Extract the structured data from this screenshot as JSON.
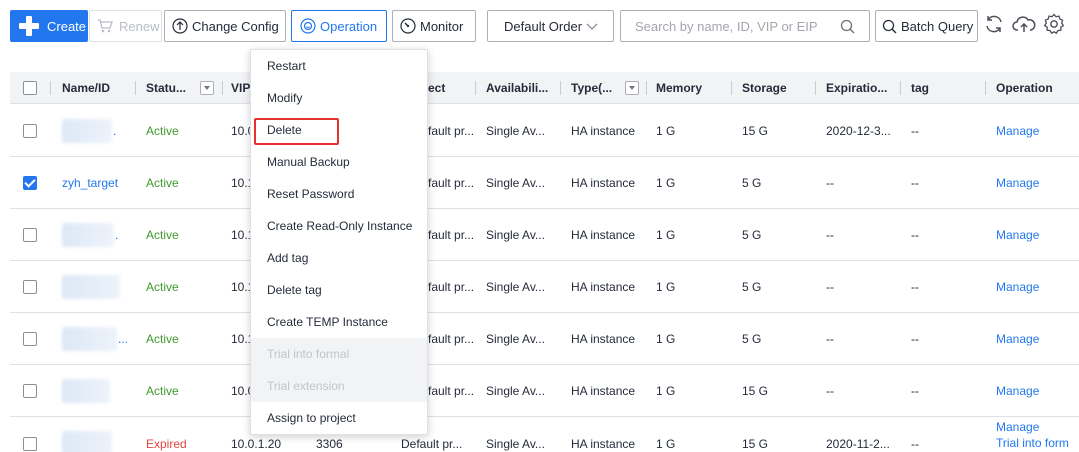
{
  "toolbar": {
    "create_label": "Create",
    "renew_label": "Renew",
    "change_config_label": "Change Config",
    "operation_label": "Operation",
    "monitor_label": "Monitor",
    "order_select_value": "Default Order",
    "search_placeholder": "Search by name, ID, VIP or EIP",
    "batch_query_label": "Batch Query"
  },
  "table": {
    "headers": {
      "name": "Name/ID",
      "status": "Statu...",
      "vip": "VIP",
      "project": "ect",
      "availability": "Availabili...",
      "type": "Type(...",
      "memory": "Memory",
      "storage": "Storage",
      "expiration": "Expiratio...",
      "tag": "tag",
      "operation": "Operation"
    },
    "rows": [
      {
        "name": ".",
        "status": "Active",
        "vip": "10.0",
        "port": "",
        "project": "fault pr...",
        "availability": "Single Av...",
        "type": "HA instance",
        "memory": "1 G",
        "storage": "15 G",
        "expiration": "2020-12-3...",
        "tag": "--",
        "operation": "Manage"
      },
      {
        "name": "zyh_target",
        "status": "Active",
        "vip": "10.1",
        "port": "",
        "project": "fault pr...",
        "availability": "Single Av...",
        "type": "HA instance",
        "memory": "1 G",
        "storage": "5 G",
        "expiration": "--",
        "tag": "--",
        "operation": "Manage"
      },
      {
        "name": ".",
        "status": "Active",
        "vip": "10.1",
        "port": "",
        "project": "fault pr...",
        "availability": "Single Av...",
        "type": "HA instance",
        "memory": "1 G",
        "storage": "5 G",
        "expiration": "--",
        "tag": "--",
        "operation": "Manage"
      },
      {
        "name": "",
        "status": "Active",
        "vip": "10.1",
        "port": "",
        "project": "fault pr...",
        "availability": "Single Av...",
        "type": "HA instance",
        "memory": "1 G",
        "storage": "5 G",
        "expiration": "--",
        "tag": "--",
        "operation": "Manage"
      },
      {
        "name": "...",
        "status": "Active",
        "vip": "10.1",
        "port": "",
        "project": "fault pr...",
        "availability": "Single Av...",
        "type": "HA instance",
        "memory": "1 G",
        "storage": "5 G",
        "expiration": "--",
        "tag": "--",
        "operation": "Manage"
      },
      {
        "name": "",
        "status": "Active",
        "vip": "10.0",
        "port": "",
        "project": "fault pr...",
        "availability": "Single Av...",
        "type": "HA instance",
        "memory": "1 G",
        "storage": "15 G",
        "expiration": "--",
        "tag": "--",
        "operation": "Manage"
      },
      {
        "name": "",
        "status": "Expired",
        "vip": "10.0.1.20",
        "port": "3306",
        "project": "Default pr...",
        "availability": "Single Av...",
        "type": "HA instance",
        "memory": "1 G",
        "storage": "15 G",
        "expiration": "2020-11-2...",
        "tag": "--",
        "operation": "Manage",
        "operation2": "Trial into form"
      }
    ]
  },
  "operation_menu": {
    "items": [
      {
        "label": "Restart",
        "disabled": false
      },
      {
        "label": "Modify",
        "disabled": false
      },
      {
        "label": "Delete",
        "disabled": false
      },
      {
        "label": "Manual Backup",
        "disabled": false
      },
      {
        "label": "Reset Password",
        "disabled": false
      },
      {
        "label": "Create Read-Only Instance",
        "disabled": false
      },
      {
        "label": "Add tag",
        "disabled": false
      },
      {
        "label": "Delete tag",
        "disabled": false
      },
      {
        "label": "Create TEMP Instance",
        "disabled": false
      },
      {
        "label": "Trial into formal",
        "disabled": true
      },
      {
        "label": "Trial extension",
        "disabled": true
      },
      {
        "label": "Assign to project",
        "disabled": false
      }
    ],
    "highlighted_item": "Delete",
    "highlight_color": "#e5322d"
  },
  "colors": {
    "primary": "#2277ee",
    "active_status": "#3e9a2c",
    "expired_status": "#e6453c"
  },
  "icons": {
    "create": "plus-icon",
    "renew": "cart-icon",
    "change_config": "arrow-up-circle-icon",
    "operation": "settings-face-icon",
    "monitor": "gauge-icon",
    "order": "chevron-down-icon",
    "search": "search-icon",
    "batch_query": "search-icon",
    "refresh": "refresh-icon",
    "export": "cloud-upload-icon",
    "settings": "gear-icon"
  }
}
